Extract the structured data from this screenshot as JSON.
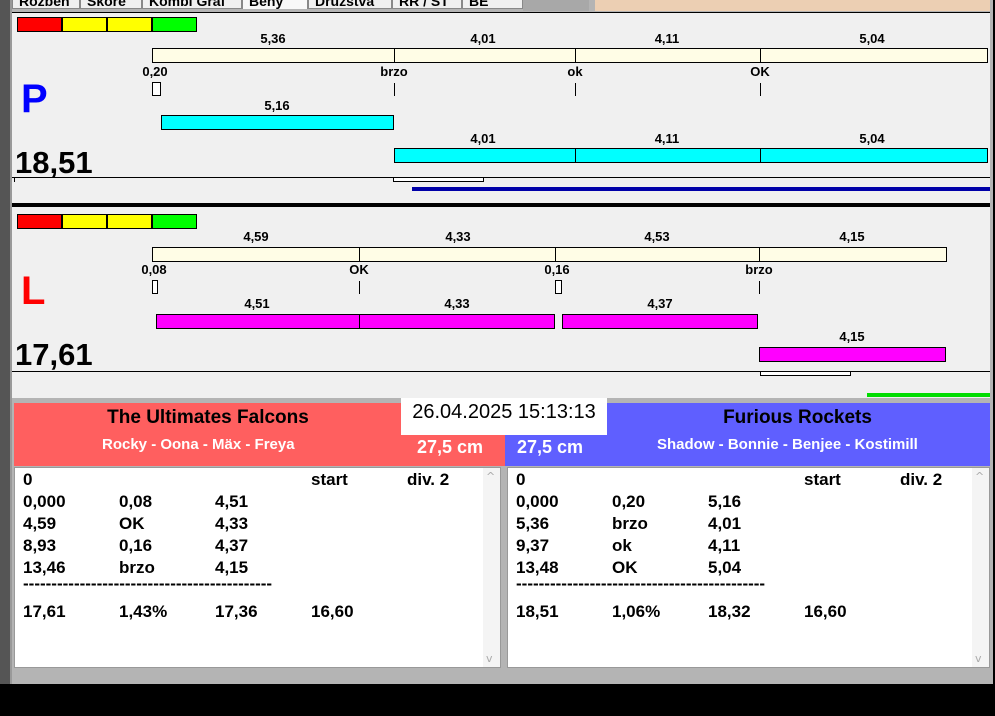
{
  "tabs": [
    "Rozbeh",
    "Skóre",
    "Kombi Graf",
    "Běhy",
    "Družstva",
    "RR / ST",
    "BE"
  ],
  "colors": {
    "red": "#ff0000",
    "yellow": "#ffff00",
    "green": "#00ff00",
    "cyan": "#00ffff",
    "magenta": "#ff00ff",
    "team_left": "#ff5f5f",
    "team_right": "#5f5fff",
    "track": "#fffde6"
  },
  "panel_p": {
    "letter": "P",
    "total": "18,51",
    "ref_top_labels": [
      "5,36",
      "4,01",
      "4,11",
      "5,04"
    ],
    "ref_bottom_labels": [
      "0,20",
      "brzo",
      "ok",
      "OK"
    ],
    "run_labels": [
      "5,16",
      "4,01",
      "4,11",
      "5,04"
    ]
  },
  "panel_l": {
    "letter": "L",
    "total": "17,61",
    "ref_top_labels": [
      "4,59",
      "4,33",
      "4,53",
      "4,15"
    ],
    "ref_bottom_labels": [
      "0,08",
      "OK",
      "0,16",
      "brzo"
    ],
    "run_labels": [
      "4,51",
      "4,33",
      "4,37",
      "4,15"
    ]
  },
  "datetime": "26.04.2025 15:13:13",
  "left_team": {
    "name": "The Ultimates Falcons",
    "players": "Rocky - Oona - Mäx - Freya",
    "height": "27,5 cm",
    "header": [
      "0",
      "",
      "",
      "start",
      "div. 2"
    ],
    "rows": [
      [
        "0,000",
        "0,08",
        "4,51"
      ],
      [
        "4,59",
        "OK",
        "4,33"
      ],
      [
        "8,93",
        "0,16",
        "4,37"
      ],
      [
        "13,46",
        "brzo",
        "4,15"
      ]
    ],
    "separator": "--------------------------------------------",
    "totals": [
      "17,61",
      "1,43%",
      "17,36",
      "16,60"
    ]
  },
  "right_team": {
    "name": "Furious Rockets",
    "players": "Shadow - Bonnie - Benjee - Kostimill",
    "height": "27,5 cm",
    "header": [
      "0",
      "",
      "",
      "start",
      "div. 2"
    ],
    "rows": [
      [
        "0,000",
        "0,20",
        "5,16"
      ],
      [
        "5,36",
        "brzo",
        "4,01"
      ],
      [
        "9,37",
        "ok",
        "4,11"
      ],
      [
        "13,48",
        "OK",
        "5,04"
      ]
    ],
    "separator": "--------------------------------------------",
    "totals": [
      "18,51",
      "1,06%",
      "18,32",
      "16,60"
    ]
  }
}
